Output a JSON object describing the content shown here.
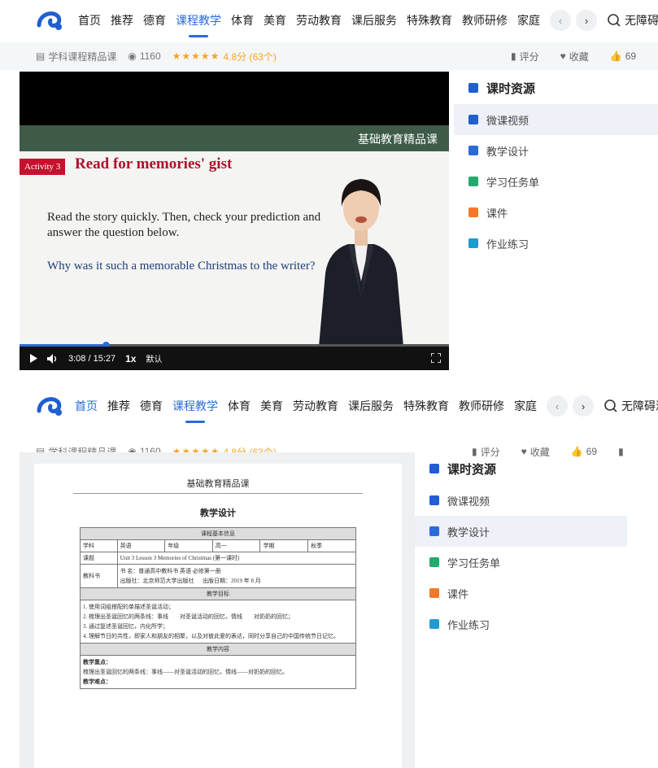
{
  "nav": {
    "items": [
      "首页",
      "推荐",
      "德育",
      "课程教学",
      "体育",
      "美育",
      "劳动教育",
      "课后服务",
      "特殊教育",
      "教师研修",
      "家庭"
    ],
    "active_index": 3,
    "accessible_label": "无障碍浏览"
  },
  "info": {
    "course_type": "学科课程精品课",
    "views": "1160",
    "stars": 5,
    "rating": "4.8分",
    "rating_count": "(63个)",
    "rate_label": "评分",
    "favorite_label": "收藏",
    "likes": "69"
  },
  "video": {
    "band_text": "基础教育精品课",
    "activity_tag": "Activity 3",
    "activity_title": "Read for memories' gist",
    "body_text": "Read the story quickly. Then, check your prediction and answer the question below.",
    "question_text": "Why was it such a memorable Christmas to the writer?",
    "time_current": "3:08",
    "time_total": "15:27",
    "progress": 0.2,
    "speed": "1x",
    "quality": "默认"
  },
  "sidebar": {
    "title": "课时资源",
    "items": [
      {
        "label": "微课视频",
        "icon": "video-icon",
        "color": "#1f5fd1"
      },
      {
        "label": "教学设计",
        "icon": "design-icon",
        "color": "#2a6bd8"
      },
      {
        "label": "学习任务单",
        "icon": "clipboard-icon",
        "color": "#26a96c"
      },
      {
        "label": "课件",
        "icon": "slides-icon",
        "color": "#f07a2a"
      },
      {
        "label": "作业练习",
        "icon": "homework-icon",
        "color": "#1f9bd1"
      }
    ],
    "active_top": 0,
    "active_bottom": 1
  },
  "doc": {
    "header": "基础教育精品课",
    "title": "教学设计",
    "basic_info_title": "课程基本信息",
    "subject_label": "学科",
    "subject_value": "英语",
    "grade_label": "年级",
    "grade_value": "高一",
    "term_label": "学期",
    "term_value": "秋季",
    "topic_label": "课题",
    "topic_value": "Unit 3 Lesson 3 Memories of Christmas (第一课时)",
    "textbook_label": "教科书",
    "textbook_name": "书  名：普通高中教科书 英语 必修第一册",
    "publisher": "出版社：北京师范大学出版社",
    "pub_date": "出版日期：2019 年 8 月",
    "goals_title": "教学目标",
    "goals": [
      "1. 使用词组搭配的单描述圣诞活动；",
      "2. 梳理出圣诞回忆的两条线：事线　　对圣诞活动的回忆，情线　　对奶奶的回忆；",
      "3. 通过复述圣诞回忆，内化所学；",
      "4. 理解节日的共性，即家人和朋友的相聚，以及对彼此爱的表达，同时分享自己的中国传统节日记忆。"
    ],
    "content_title": "教学内容",
    "key_title": "教学重点：",
    "key_text": "梳理出圣诞回忆的两条线：事线——对圣诞活动的回忆，情线——对奶奶的回忆。",
    "difficulty_title": "教学难点："
  }
}
